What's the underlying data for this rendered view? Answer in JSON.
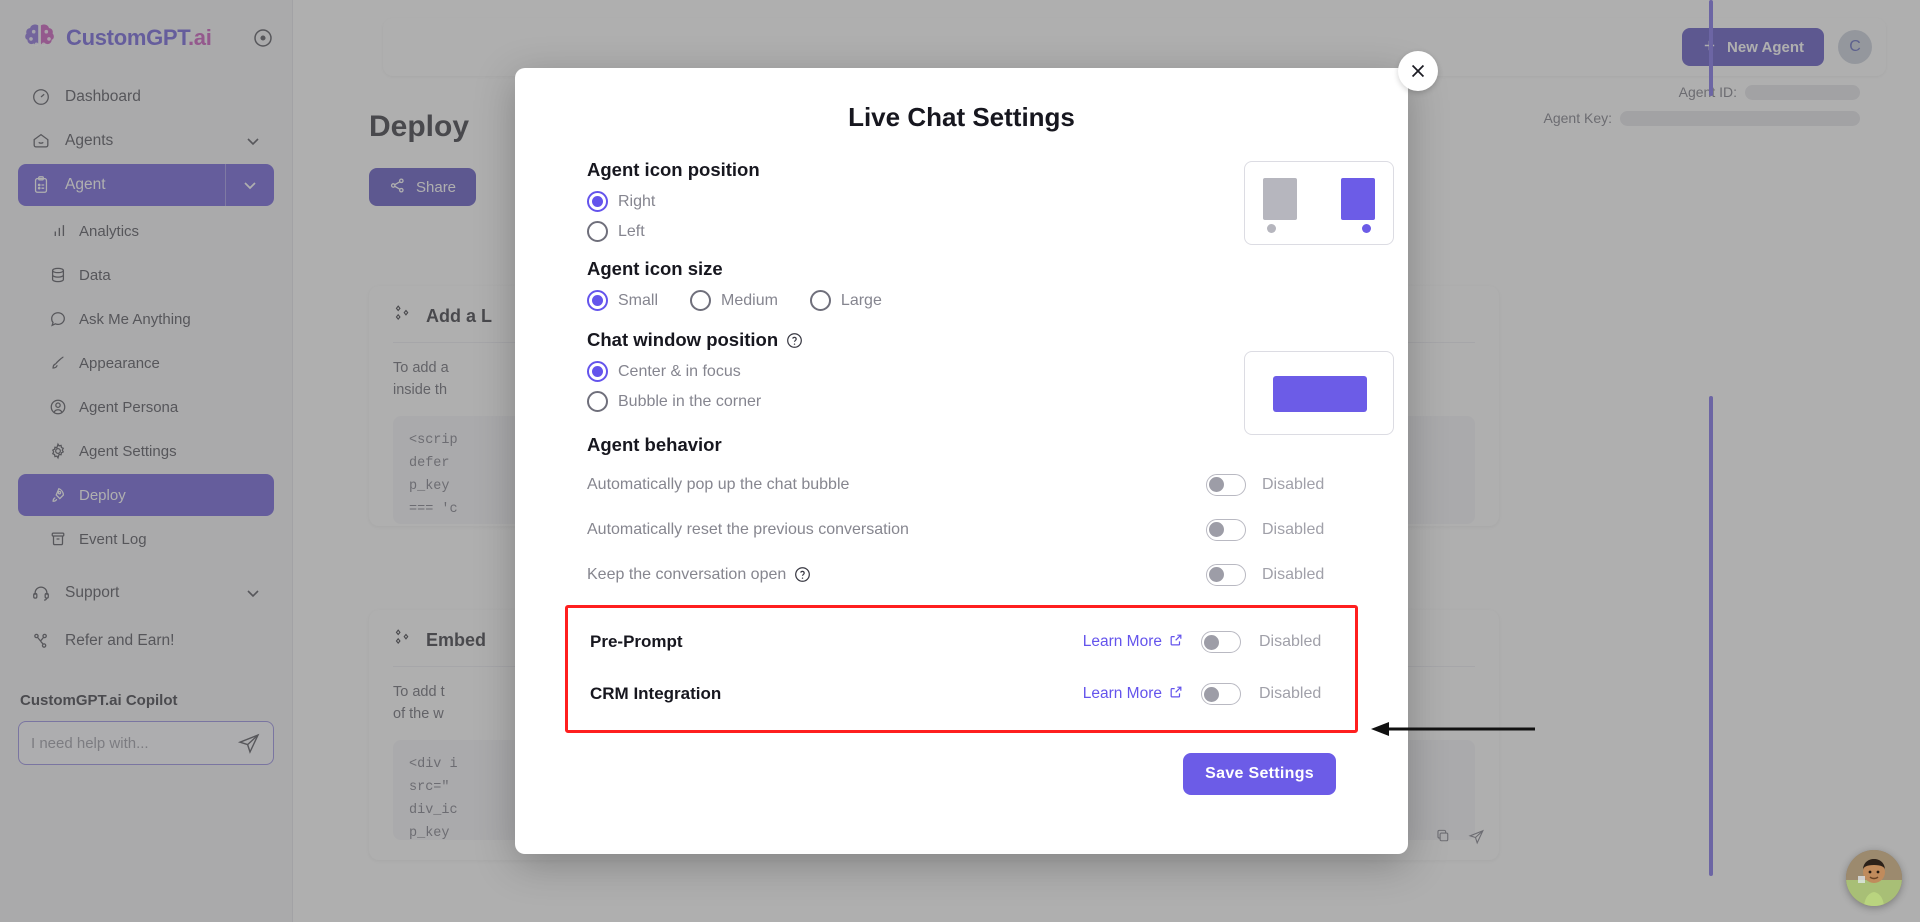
{
  "sidebar": {
    "brand": {
      "part1": "CustomGPT",
      "part2": ".ai",
      "collapse_icon": "collapse-icon"
    },
    "items": [
      {
        "label": "Dashboard",
        "icon": "dashboard-icon"
      },
      {
        "label": "Agents",
        "icon": "agents-icon",
        "chevron": "chevron-down-icon"
      }
    ],
    "active_group": {
      "label": "Agent",
      "icon": "clipboard-icon",
      "chevron": "chevron-down-icon"
    },
    "sub_items": [
      {
        "label": "Analytics",
        "icon": "analytics-icon"
      },
      {
        "label": "Data",
        "icon": "database-icon"
      },
      {
        "label": "Ask Me Anything",
        "icon": "chat-icon"
      },
      {
        "label": "Appearance",
        "icon": "brush-icon"
      },
      {
        "label": "Agent Persona",
        "icon": "user-circle-icon"
      },
      {
        "label": "Agent Settings",
        "icon": "gear-icon"
      },
      {
        "label": "Deploy",
        "icon": "rocket-icon",
        "active": true
      },
      {
        "label": "Event Log",
        "icon": "archive-icon"
      }
    ],
    "footer_items": [
      {
        "label": "Support",
        "icon": "headset-icon",
        "chevron": "chevron-down-icon"
      },
      {
        "label": "Refer and Earn!",
        "icon": "share-nodes-icon"
      }
    ],
    "copilot": {
      "title": "CustomGPT.ai Copilot",
      "placeholder": "I need help with...",
      "value": "",
      "send_icon": "send-icon"
    }
  },
  "topbar": {
    "new_agent_label": "New Agent",
    "new_agent_icon": "plus-icon",
    "avatar_initial": "C"
  },
  "page": {
    "title": "Deploy",
    "share_label": "Share",
    "share_icon": "share-icon",
    "agent_id_label": "Agent ID:",
    "agent_key_label": "Agent Key:",
    "cards": [
      {
        "heading": "Add a L",
        "icon": "sparkle-icon",
        "body_line1": "To add a",
        "body_line2": "inside th",
        "code": "<scrip\ndefer\np_key\n=== 'c\n</scr"
      },
      {
        "heading": "Embed",
        "icon": "sparkle-icon",
        "body_line1": "To add t",
        "body_line2": "of the w",
        "code": "<div i\nsrc=\"\ndiv_ic\np_key"
      }
    ]
  },
  "modal": {
    "title": "Live Chat Settings",
    "close_icon": "close-icon",
    "sections": {
      "icon_position": {
        "title": "Agent icon position",
        "options": [
          {
            "label": "Right",
            "selected": true
          },
          {
            "label": "Left",
            "selected": false
          }
        ],
        "preview": "preview-icon-position"
      },
      "icon_size": {
        "title": "Agent icon size",
        "options": [
          {
            "label": "Small",
            "selected": true
          },
          {
            "label": "Medium",
            "selected": false
          },
          {
            "label": "Large",
            "selected": false
          }
        ]
      },
      "chat_window_position": {
        "title": "Chat window position",
        "help_icon": "help-icon",
        "options": [
          {
            "label": "Center & in focus",
            "selected": true
          },
          {
            "label": "Bubble in the corner",
            "selected": false
          }
        ],
        "preview": "preview-chat-position"
      },
      "agent_behavior": {
        "title": "Agent behavior",
        "rows": [
          {
            "label": "Automatically pop up the chat bubble",
            "state": "Disabled",
            "enabled": false,
            "help": false,
            "learn_more": null
          },
          {
            "label": "Automatically reset the previous conversation",
            "state": "Disabled",
            "enabled": false,
            "help": false,
            "learn_more": null
          },
          {
            "label": "Keep the conversation open",
            "state": "Disabled",
            "enabled": false,
            "help": true,
            "learn_more": null
          }
        ],
        "highlighted_rows": [
          {
            "label": "Pre-Prompt",
            "state": "Disabled",
            "enabled": false,
            "learn_more": "Learn More",
            "learn_more_icon": "external-link-icon"
          },
          {
            "label": "CRM Integration",
            "state": "Disabled",
            "enabled": false,
            "learn_more": "Learn More",
            "learn_more_icon": "external-link-icon"
          }
        ]
      }
    },
    "save_label": "Save Settings"
  },
  "annotations": {
    "highlight_color": "#ff1f1f",
    "arrow_color": "#111111",
    "arrow_name": "annotation-arrow"
  },
  "colors": {
    "brand_purple": "#5b4bd6",
    "accent": "#6c5ce7",
    "button_purple": "#4b3fbb"
  }
}
